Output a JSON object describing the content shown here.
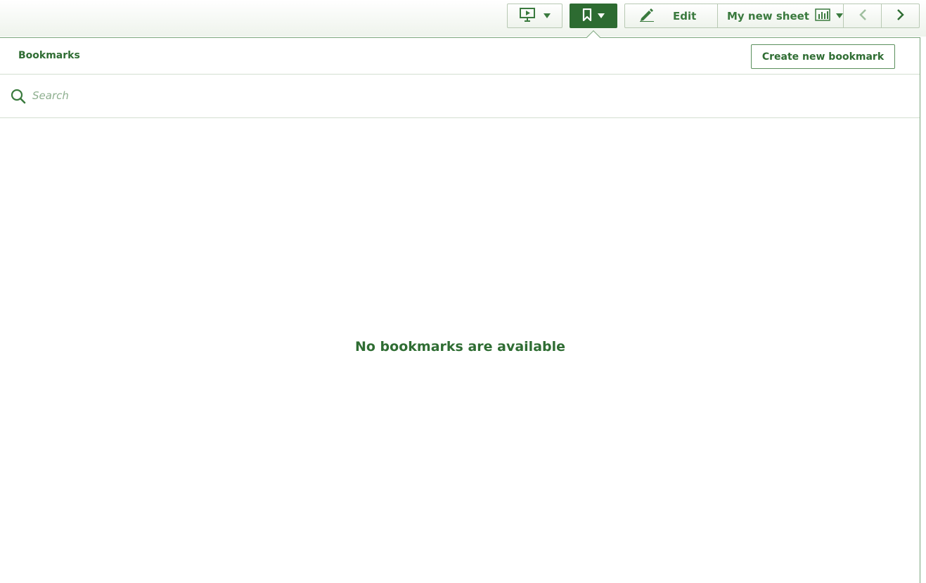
{
  "toolbar": {
    "present_icon": "presentation-play-icon",
    "bookmark_icon": "bookmark-icon",
    "edit_icon": "pencil-icon",
    "edit_label": "Edit",
    "sheet_name": "My new sheet",
    "sheet_icon": "bar-chart-icon",
    "prev_icon": "chevron-left-icon",
    "next_icon": "chevron-right-icon"
  },
  "bookmarks_panel": {
    "title": "Bookmarks",
    "create_button_label": "Create new bookmark",
    "search_placeholder": "Search",
    "search_value": "",
    "empty_message": "No bookmarks are available"
  },
  "colors": {
    "accent": "#2d6b31",
    "text_green": "#2f6d33",
    "border": "#7aa57b"
  }
}
